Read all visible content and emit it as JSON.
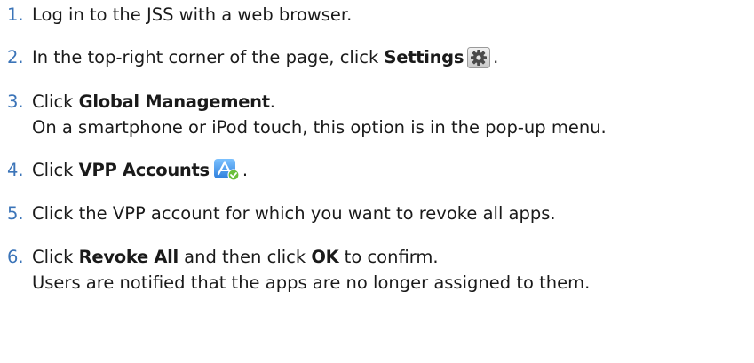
{
  "steps": [
    {
      "number": "1.",
      "text": "Log in to the JSS with a web browser."
    },
    {
      "number": "2.",
      "before": "In the top-right corner of the page, click ",
      "bold": "Settings",
      "after": ".",
      "icon": "settings-gear-icon"
    },
    {
      "number": "3.",
      "before": "Click ",
      "bold": "Global Management",
      "after": ".",
      "note": "On a smartphone or iPod touch, this option is in the pop-up menu."
    },
    {
      "number": "4.",
      "before": "Click ",
      "bold": "VPP Accounts",
      "after": ".",
      "icon": "vpp-app-store-icon"
    },
    {
      "number": "5.",
      "text": "Click the VPP account for which you want to revoke all apps."
    },
    {
      "number": "6.",
      "before": "Click ",
      "bold": "Revoke All",
      "middle": " and then click ",
      "bold2": "OK",
      "after": " to confirm.",
      "note": "Users are notified that the apps are no longer assigned to them."
    }
  ],
  "colors": {
    "number": "#3b74b8",
    "text": "#1a1a1a",
    "gear_bg": "#dcdcdc",
    "vpp_blue": "#3e8fe6",
    "vpp_check": "#6bbf3a"
  }
}
